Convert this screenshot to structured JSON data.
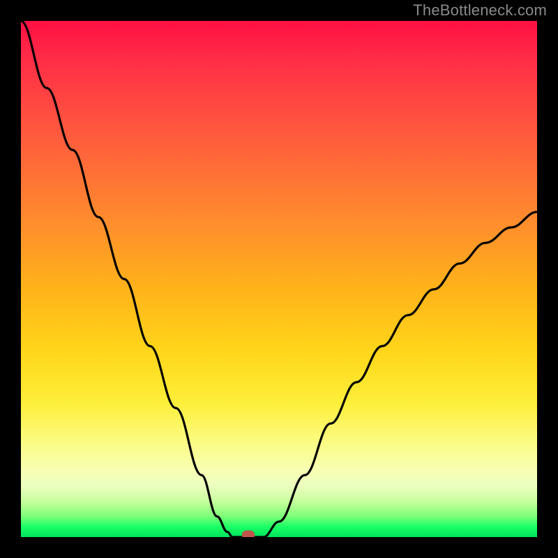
{
  "watermark": "TheBottleneck.com",
  "chart_data": {
    "type": "line",
    "title": "",
    "xlabel": "",
    "ylabel": "",
    "xlim": [
      0,
      100
    ],
    "ylim": [
      0,
      100
    ],
    "grid": false,
    "legend": false,
    "series": [
      {
        "name": "bottleneck-curve",
        "x": [
          0,
          5,
          10,
          15,
          20,
          25,
          30,
          35,
          38,
          40,
          41,
          42,
          43,
          47,
          50,
          55,
          60,
          65,
          70,
          75,
          80,
          85,
          90,
          95,
          100
        ],
        "values": [
          100,
          87,
          75,
          62,
          50,
          37,
          25,
          12,
          4,
          1,
          0,
          0,
          0,
          0,
          3,
          12,
          22,
          30,
          37,
          43,
          48,
          53,
          57,
          60,
          63
        ]
      }
    ],
    "flat_segment": {
      "x_start": 41,
      "x_end": 47,
      "value": 0
    },
    "marker": {
      "x": 44,
      "y": 0,
      "color": "#c25549"
    },
    "gradient_stops": [
      {
        "pos": 0,
        "color": "#ff1044"
      },
      {
        "pos": 50,
        "color": "#ffc81a"
      },
      {
        "pos": 85,
        "color": "#f8ff9a"
      },
      {
        "pos": 100,
        "color": "#00e25c"
      }
    ]
  }
}
